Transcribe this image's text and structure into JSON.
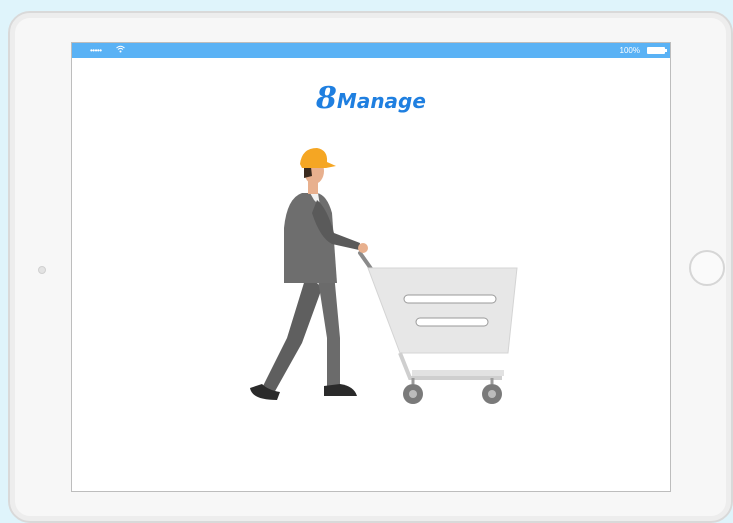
{
  "status_bar": {
    "signal": "•••••",
    "battery_percent": "100%",
    "icons": [
      "wifi-icon",
      "battery-icon"
    ]
  },
  "app": {
    "logo_mark": "8",
    "logo_text": "Manage"
  },
  "illustration": {
    "subject": "man-pushing-shopping-cart"
  },
  "colors": {
    "status_bar": "#5ab2f5",
    "logo": "#1f7fe0",
    "background": "#dff4fb",
    "hat": "#f5a623",
    "suit": "#6b6b6b",
    "cart": "#e6e6e6"
  }
}
